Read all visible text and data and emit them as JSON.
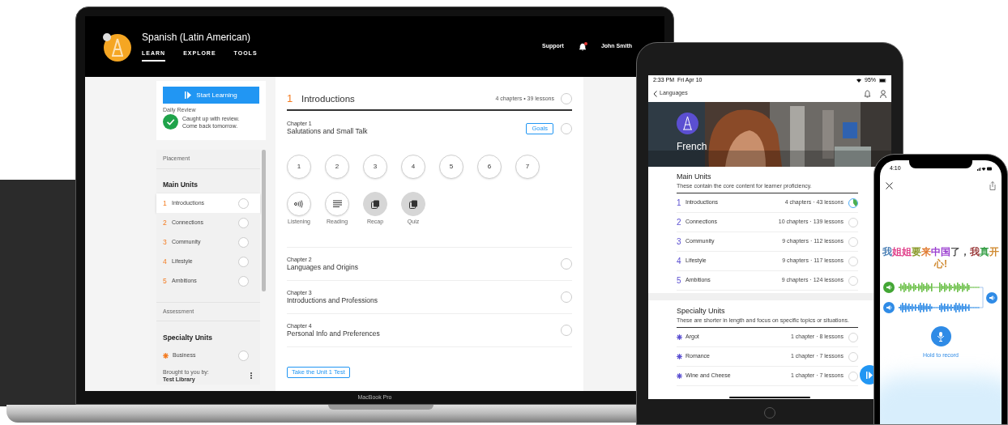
{
  "laptop": {
    "label": "MacBook Pro",
    "header": {
      "course_title": "Spanish (Latin American)",
      "nav": [
        {
          "label": "LEARN",
          "selected": true
        },
        {
          "label": "EXPLORE",
          "selected": false
        },
        {
          "label": "TOOLS",
          "selected": false
        }
      ],
      "support": "Support",
      "notification": true,
      "user": "John Smith"
    },
    "sidebar": {
      "start_button": "Start Learning",
      "daily_review": {
        "title": "Daily Review",
        "lines": [
          "Caught up with review.",
          "Come back tomorrow."
        ]
      },
      "placement": "Placement",
      "main_units": {
        "title": "Main Units",
        "items": [
          {
            "number": "1",
            "label": "Introductions",
            "selected": true
          },
          {
            "number": "2",
            "label": "Connections",
            "selected": false
          },
          {
            "number": "3",
            "label": "Community",
            "selected": false
          },
          {
            "number": "4",
            "label": "Lifestyle",
            "selected": false
          },
          {
            "number": "5",
            "label": "Ambitions",
            "selected": false
          }
        ]
      },
      "assessment": "Assessment",
      "specialty_units": {
        "title": "Specialty Units",
        "items": [
          {
            "label": "Business",
            "selected": false
          }
        ]
      },
      "footer": {
        "caption": "Brought to you by:",
        "library": "Test Library"
      }
    },
    "main": {
      "unit": {
        "number": "1",
        "title": "Introductions",
        "summary": "4 chapters • 39 lessons"
      },
      "chapters": [
        {
          "label": "Chapter 1",
          "title": "Salutations and Small Talk",
          "goals": "Goals",
          "lessons": [
            {
              "kind": "number",
              "label": "1"
            },
            {
              "kind": "number",
              "label": "2"
            },
            {
              "kind": "number",
              "label": "3"
            },
            {
              "kind": "number",
              "label": "4"
            },
            {
              "kind": "number",
              "label": "5"
            },
            {
              "kind": "number",
              "label": "6"
            },
            {
              "kind": "number",
              "label": "7"
            },
            {
              "kind": "listening",
              "caption": "Listening"
            },
            {
              "kind": "reading",
              "caption": "Reading"
            },
            {
              "kind": "recap",
              "caption": "Recap"
            },
            {
              "kind": "quiz",
              "caption": "Quiz"
            }
          ]
        },
        {
          "label": "Chapter 2",
          "title": "Languages and Origins"
        },
        {
          "label": "Chapter 3",
          "title": "Introductions and Professions"
        },
        {
          "label": "Chapter 4",
          "title": "Personal Info and Preferences"
        }
      ],
      "test_button": "Take the Unit 1 Test"
    }
  },
  "tablet": {
    "status": {
      "time": "2:33 PM",
      "date": "Fri Apr 10",
      "battery": "95%"
    },
    "back": "Languages",
    "language": "French",
    "main_units": {
      "title": "Main Units",
      "description": "These contain the core content for learner proficiency.",
      "items": [
        {
          "number": "1",
          "label": "Introductions",
          "summary": "4 chapters · 43 lessons",
          "level": 0.4
        },
        {
          "number": "2",
          "label": "Connections",
          "summary": "10 chapters · 139 lessons",
          "level": 0
        },
        {
          "number": "3",
          "label": "Community",
          "summary": "9 chapters · 112 lessons",
          "level": 0
        },
        {
          "number": "4",
          "label": "Lifestyle",
          "summary": "9 chapters · 117 lessons",
          "level": 0
        },
        {
          "number": "5",
          "label": "Ambitions",
          "summary": "9 chapters · 124 lessons",
          "level": 0
        }
      ]
    },
    "specialty_units": {
      "title": "Specialty Units",
      "description": "These are shorter in length and focus on specific topics or situations.",
      "items": [
        {
          "label": "Argot",
          "summary": "1 chapter · 8 lessons",
          "level": 0
        },
        {
          "label": "Romance",
          "summary": "1 chapter · 7 lessons",
          "level": 0
        },
        {
          "label": "Wine and Cheese",
          "summary": "1 chapter · 7 lessons",
          "level": 0
        }
      ]
    }
  },
  "phone": {
    "time": "4:10",
    "sentence": [
      {
        "text": "我",
        "color": "#4a7fb5"
      },
      {
        "text": "姐姐",
        "color": "#e0408a"
      },
      {
        "text": "要",
        "color": "#8a9a2a"
      },
      {
        "text": "来",
        "color": "#e07a30"
      },
      {
        "text": "中国",
        "color": "#9b3fd0"
      },
      {
        "text": "了，",
        "color": "#555555"
      },
      {
        "text": "我",
        "color": "#9a3a3a"
      },
      {
        "text": "真",
        "color": "#3aa04a"
      },
      {
        "text": "开心!",
        "color": "#d08a30"
      }
    ],
    "record_hint": "Hold to record"
  }
}
